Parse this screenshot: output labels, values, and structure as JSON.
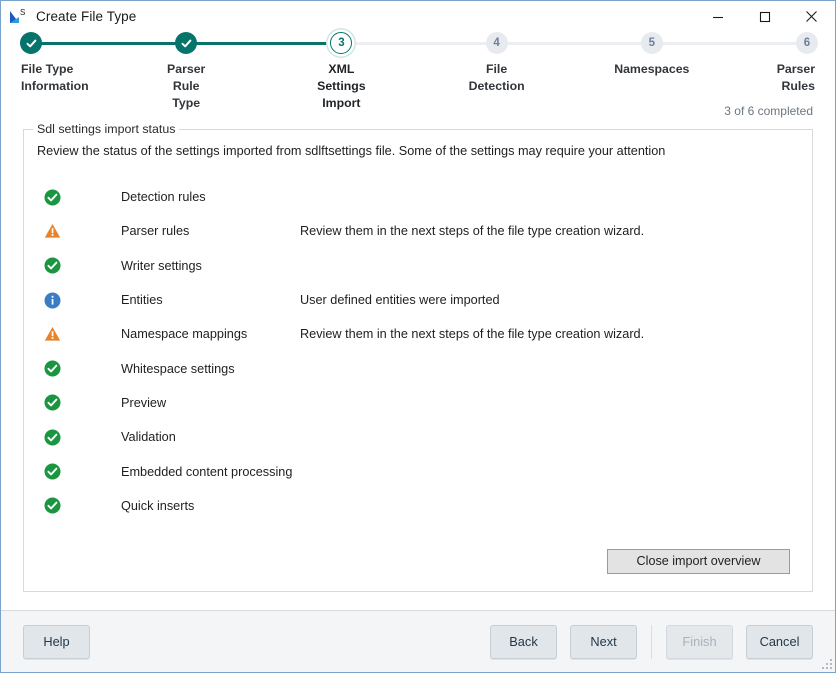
{
  "window": {
    "title": "Create File Type",
    "icon": "sdl-logo-icon",
    "controls": {
      "minimize": "minimize-icon",
      "maximize": "maximize-icon",
      "close": "close-icon"
    }
  },
  "stepper": {
    "completed_note": "3 of 6 completed",
    "steps": [
      {
        "number": "1",
        "label": "File Type\nInformation",
        "state": "done"
      },
      {
        "number": "2",
        "label": "Parser Rule Type",
        "state": "done"
      },
      {
        "number": "3",
        "label": "XML Settings Import",
        "state": "current"
      },
      {
        "number": "4",
        "label": "File Detection",
        "state": "todo"
      },
      {
        "number": "5",
        "label": "Namespaces",
        "state": "todo"
      },
      {
        "number": "6",
        "label": "Parser Rules",
        "state": "todo"
      }
    ]
  },
  "groupbox": {
    "legend": "Sdl settings import status",
    "description": "Review the status of the settings imported from sdlftsettings file. Some of the settings may require your attention",
    "rows": [
      {
        "icon": "success-check-icon",
        "status": "success",
        "name": "Detection rules",
        "desc": ""
      },
      {
        "icon": "warning-triangle-icon",
        "status": "warning",
        "name": "Parser rules",
        "desc": "Review them in the next steps of the file type creation wizard."
      },
      {
        "icon": "success-check-icon",
        "status": "success",
        "name": "Writer settings",
        "desc": ""
      },
      {
        "icon": "info-circle-icon",
        "status": "info",
        "name": "Entities",
        "desc": "User defined entities were imported"
      },
      {
        "icon": "warning-triangle-icon",
        "status": "warning",
        "name": "Namespace mappings",
        "desc": "Review them in the next steps of the file type creation wizard."
      },
      {
        "icon": "success-check-icon",
        "status": "success",
        "name": "Whitespace settings",
        "desc": ""
      },
      {
        "icon": "success-check-icon",
        "status": "success",
        "name": "Preview",
        "desc": ""
      },
      {
        "icon": "success-check-icon",
        "status": "success",
        "name": "Validation",
        "desc": ""
      },
      {
        "icon": "success-check-icon",
        "status": "success",
        "name": "Embedded content processing",
        "desc": ""
      },
      {
        "icon": "success-check-icon",
        "status": "success",
        "name": "Quick inserts",
        "desc": ""
      }
    ],
    "close_overview_label": "Close import overview"
  },
  "footer": {
    "help_label": "Help",
    "back_label": "Back",
    "next_label": "Next",
    "finish_label": "Finish",
    "cancel_label": "Cancel",
    "finish_disabled": true
  },
  "colors": {
    "accent_teal": "#06746b",
    "success_green": "#1a9641",
    "warning_orange": "#e8832a",
    "info_blue": "#3b7dc4",
    "step_todo_bg": "#e7eaef",
    "window_border": "#7aa3cc",
    "footer_bg": "#f4f5f6"
  }
}
